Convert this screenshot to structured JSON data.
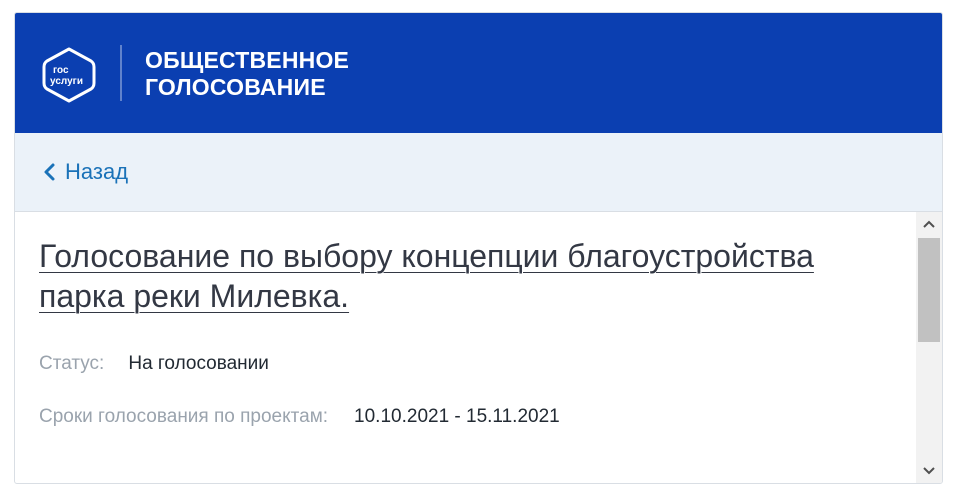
{
  "header": {
    "logo_text_line1": "гос",
    "logo_text_line2": "услуги",
    "title_line1": "ОБЩЕСТВЕННОЕ",
    "title_line2": "ГОЛОСОВАНИЕ",
    "background_color": "#0b3fb1"
  },
  "nav": {
    "back_label": "Назад",
    "back_icon": "chevron-left-icon",
    "link_color": "#1a72b8"
  },
  "vote": {
    "title": "Голосование по выбору концепции благоустройства парка реки Милевка.",
    "status_label": "Статус:",
    "status_value": "На голосовании",
    "dates_label": "Сроки голосования по проектам:",
    "dates_value": "10.10.2021 - 15.11.2021"
  },
  "scrollbar": {
    "up_icon": "chevron-up-icon",
    "down_icon": "chevron-down-icon"
  }
}
